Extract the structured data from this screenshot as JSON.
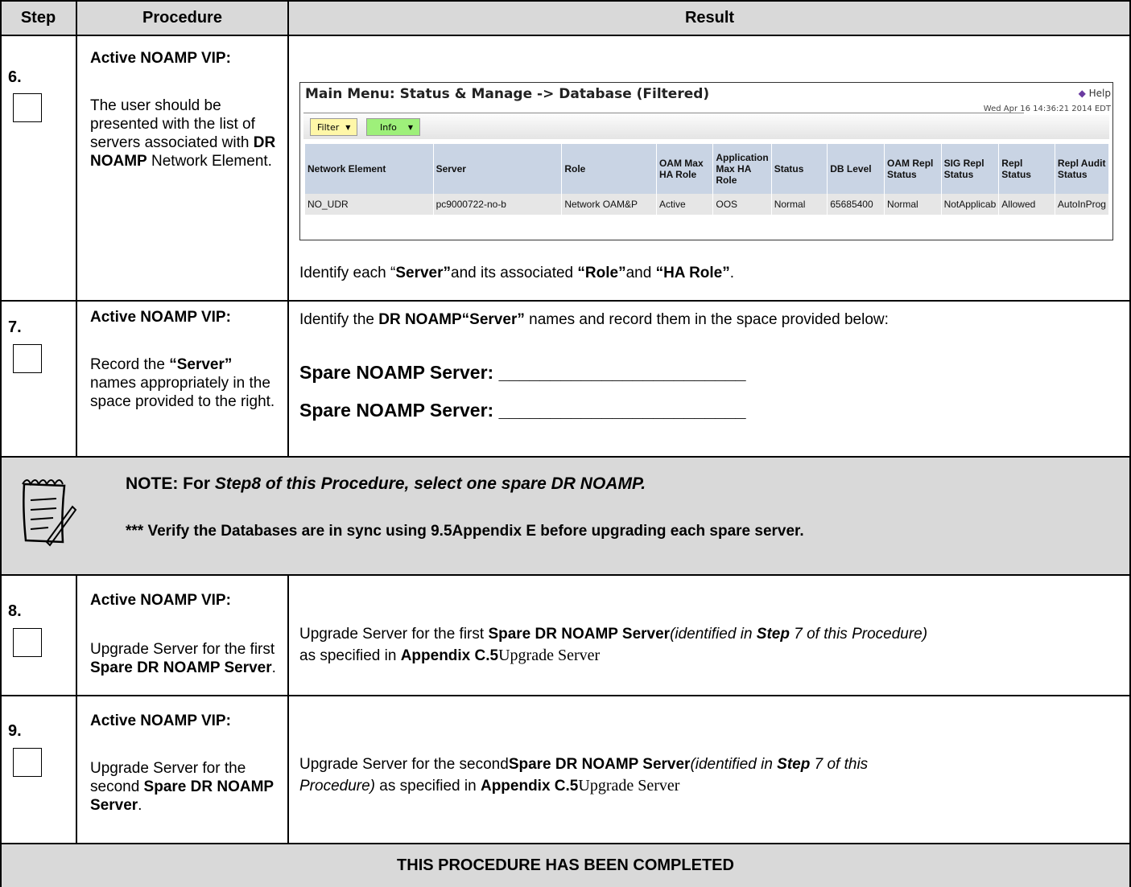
{
  "table": {
    "headers": {
      "step": "Step",
      "procedure": "Procedure",
      "result": "Result"
    }
  },
  "step6": {
    "number": "6.",
    "title": "Active NOAMP VIP:",
    "text_pre": "The user should be presented with the list of servers associated with ",
    "text_bold": "DR NOAMP",
    "text_post": " Network Element.",
    "result_pre": "Identify each “",
    "result_b1": "Server”",
    "result_mid1": "and its associated ",
    "result_b2": "“Role”",
    "result_mid2": "and ",
    "result_b3": "“HA Role”",
    "result_post": "."
  },
  "screenshot": {
    "title": "Main Menu: Status & Manage -> Database (Filtered)",
    "help": "Help",
    "timestamp": "Wed Apr 16 14:36:21 2014 EDT",
    "filter_button": "Filter",
    "info_button": "Info",
    "columns": [
      "Network Element",
      "Server",
      "Role",
      "OAM Max HA Role",
      "Application Max HA Role",
      "Status",
      "DB Level",
      "OAM Repl Status",
      "SIG Repl Status",
      "Repl Status",
      "Repl Audit Status"
    ],
    "row": [
      "NO_UDR",
      "pc9000722-no-b",
      "Network OAM&P",
      "Active",
      "OOS",
      "Normal",
      "65685400",
      "Normal",
      "NotApplicab",
      "Allowed",
      "AutoInProg"
    ]
  },
  "step7": {
    "number": "7.",
    "title": "Active NOAMP VIP:",
    "text_pre": "Record the ",
    "text_bold": "“Server”",
    "text_post": " names appropriately in the space provided to the right.",
    "result_pre": "Identify the ",
    "result_bold": "DR NOAMP“Server”",
    "result_post": " names and record them in the space provided below:",
    "field1": "Spare NOAMP Server: ________________________",
    "field2": "Spare NOAMP Server: ________________________"
  },
  "note": {
    "line1_bold": "NOTE:  For ",
    "line1_italic": "Step8 of this Procedure, select one spare DR NOAMP.",
    "line2": "*** Verify the Databases are in sync using 9.5Appendix E before upgrading each spare server."
  },
  "step8": {
    "number": "8.",
    "title": "Active NOAMP VIP:",
    "text_pre": "Upgrade Server for the first ",
    "text_bold": "Spare DR NOAMP Server",
    "text_post": ".",
    "result_pre": "Upgrade Server for the first ",
    "result_bold": "Spare DR NOAMP Server",
    "result_italic1": "(identified in ",
    "result_italic_bold": "Step",
    "result_italic2": " 7 of this Procedure)",
    "result_line2_pre": "as specified in ",
    "result_line2_bold": "Appendix C.5",
    "result_line2_serif": "Upgrade Server"
  },
  "step9": {
    "number": "9.",
    "title": "Active NOAMP VIP:",
    "text_pre": "Upgrade Server for the second ",
    "text_bold": "Spare DR NOAMP Server",
    "text_post": ".",
    "result_pre": "Upgrade Server for the second",
    "result_bold": "Spare DR NOAMP Server",
    "result_italic1": "(identified in ",
    "result_italic_bold": "Step",
    "result_italic2": " 7 of this",
    "result_line2_italic": "Procedure)",
    "result_line2_pre": " as specified in ",
    "result_line2_bold": "Appendix C.5",
    "result_line2_serif": "Upgrade Server"
  },
  "footer": {
    "text": "THIS PROCEDURE HAS BEEN COMPLETED"
  }
}
